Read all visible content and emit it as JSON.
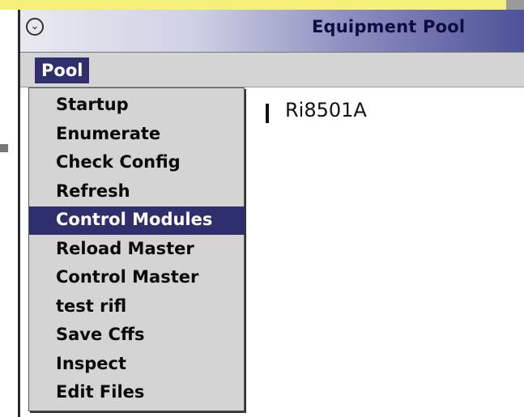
{
  "window": {
    "title": "Equipment Pool",
    "collapse_glyph": "⌄"
  },
  "menubar": {
    "menu_title": "Pool"
  },
  "content": {
    "equipment_name": "Ri8501A"
  },
  "dropdown": {
    "selected_index": 4,
    "items": [
      {
        "label": "Startup"
      },
      {
        "label": "Enumerate"
      },
      {
        "label": "Check Config"
      },
      {
        "label": "Refresh"
      },
      {
        "label": "Control Modules"
      },
      {
        "label": "Reload Master"
      },
      {
        "label": "Control Master"
      },
      {
        "label": "test rifl"
      },
      {
        "label": "Save Cffs"
      },
      {
        "label": "Inspect"
      },
      {
        "label": "Edit Files"
      }
    ]
  },
  "colors": {
    "selection": "#2f2f6e",
    "menu_bg": "#d4d4d4",
    "background_window_yellow": "#f5f07a"
  }
}
